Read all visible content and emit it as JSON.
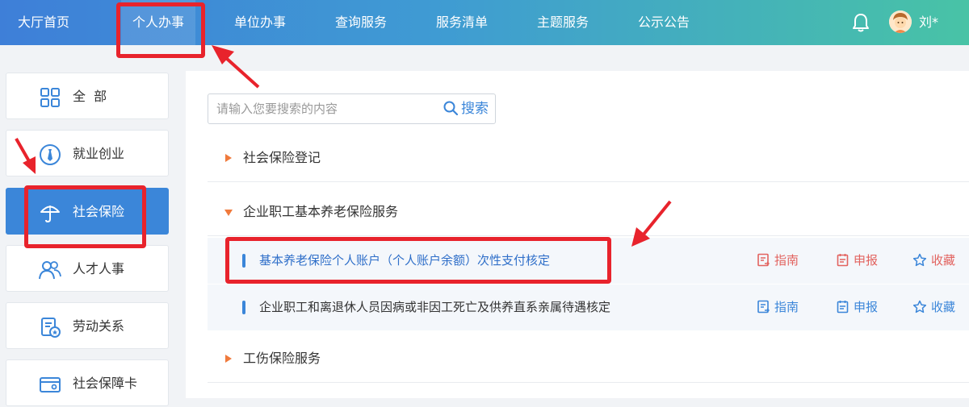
{
  "nav": {
    "items": [
      {
        "label": "大厅首页"
      },
      {
        "label": "个人办事"
      },
      {
        "label": "单位办事"
      },
      {
        "label": "查询服务"
      },
      {
        "label": "服务清单"
      },
      {
        "label": "主题服务"
      },
      {
        "label": "公示公告"
      }
    ],
    "active_index": 1,
    "bell_icon": "bell-icon",
    "user_name": "刘*"
  },
  "sidebar": {
    "items": [
      {
        "label": "全  部",
        "icon": "grid-icon"
      },
      {
        "label": "就业创业",
        "icon": "tie-icon"
      },
      {
        "label": "社会保险",
        "icon": "umbrella-icon",
        "active": true
      },
      {
        "label": "人才人事",
        "icon": "people-icon"
      },
      {
        "label": "劳动关系",
        "icon": "document-badge-icon"
      },
      {
        "label": "社会保障卡",
        "icon": "card-icon"
      }
    ]
  },
  "search": {
    "placeholder": "请输入您要搜索的内容",
    "button_label": "搜索"
  },
  "sections": [
    {
      "label": "社会保险登记",
      "expanded": false
    },
    {
      "label": "企业职工基本养老保险服务",
      "expanded": true
    },
    {
      "label": "工伤保险服务",
      "expanded": false
    }
  ],
  "services": [
    {
      "label": "基本养老保险个人账户（个人账户余额）次性支付核定",
      "guide": "指南",
      "apply": "申报",
      "favorite": "收藏"
    },
    {
      "label": "企业职工和离退休人员因病或非因工死亡及供养直系亲属待遇核定",
      "guide": "指南",
      "apply": "申报",
      "favorite": "收藏"
    }
  ],
  "colors": {
    "nav_gradient_start": "#3e7fd8",
    "nav_gradient_end": "#48c3a6",
    "accent_blue": "#3b86d9",
    "section_arrow": "#f07a3c",
    "action_red": "#e2635f",
    "annotation_red": "#e8232c"
  }
}
